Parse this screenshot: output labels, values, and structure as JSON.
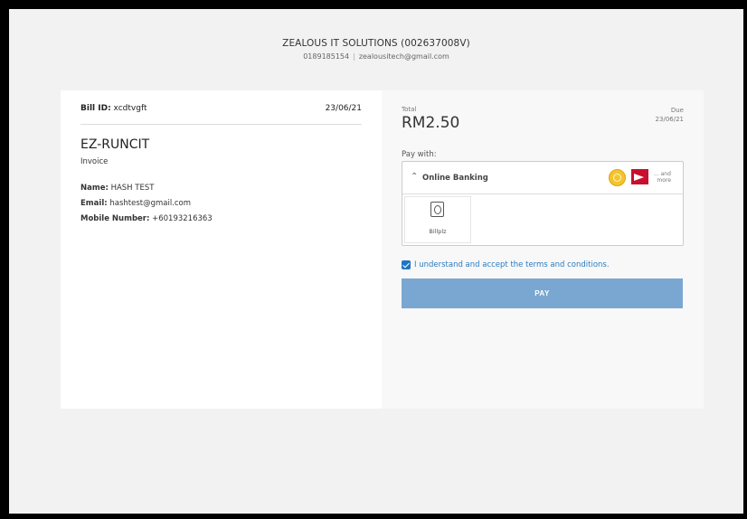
{
  "merchant": {
    "name": "ZEALOUS IT SOLUTIONS (002637008V)",
    "phone": "0189185154",
    "email": "zealousitech@gmail.com"
  },
  "bill": {
    "id_label": "Bill ID:",
    "id_value": "xcdtvgft",
    "date": "23/06/21",
    "organization": "EZ-RUNCIT",
    "doc_type": "Invoice",
    "name_label": "Name:",
    "name_value": "HASH TEST",
    "email_label": "Email:",
    "email_value": "hashtest@gmail.com",
    "mobile_label": "Mobile Number:",
    "mobile_value": "+60193216363"
  },
  "payment": {
    "total_label": "Total",
    "total_amount": "RM2.50",
    "due_label": "Due",
    "due_date": "23/06/21",
    "pay_with_label": "Pay with:",
    "method_label": "Online Banking",
    "and_more_line1": "... and",
    "and_more_line2": "more",
    "gateway_label": "Billplz",
    "terms_text": "I understand and accept the terms and conditions.",
    "pay_button": "PAY"
  },
  "colors": {
    "accent": "#1f74c4",
    "pay_button": "#7aa7d1",
    "link": "#2a7bbf"
  },
  "icons": {
    "expand": "chevron-up-icon",
    "bank_logo_1": "bank-logo-gold",
    "bank_logo_2": "bank-logo-red",
    "gateway": "billplz-icon",
    "checkbox": "checkmark-icon"
  }
}
